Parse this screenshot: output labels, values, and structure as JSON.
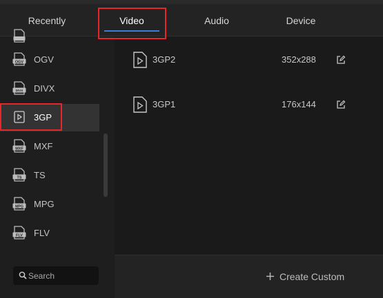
{
  "tabs": [
    {
      "label": "Recently",
      "active": false
    },
    {
      "label": "Video",
      "active": true
    },
    {
      "label": "Audio",
      "active": false
    },
    {
      "label": "Device",
      "active": false
    }
  ],
  "formats": [
    {
      "label": "",
      "icon": "film-format-icon",
      "badge": ""
    },
    {
      "label": "OGV",
      "icon": "ogv-format-icon",
      "badge": "OGV"
    },
    {
      "label": "DIVX",
      "icon": "divx-format-icon",
      "badge": "DIVX"
    },
    {
      "label": "3GP",
      "icon": "play-file-icon",
      "badge": "",
      "selected": true
    },
    {
      "label": "MXF",
      "icon": "mxf-format-icon",
      "badge": "MXF"
    },
    {
      "label": "TS",
      "icon": "ts-format-icon",
      "badge": "TS"
    },
    {
      "label": "MPG",
      "icon": "mpg-format-icon",
      "badge": "MPG"
    },
    {
      "label": "FLV",
      "icon": "flv-format-icon",
      "badge": "FLV"
    }
  ],
  "search": {
    "placeholder": "Search",
    "value": ""
  },
  "presets": [
    {
      "name": "3GP2",
      "resolution": "352x288"
    },
    {
      "name": "3GP1",
      "resolution": "176x144"
    }
  ],
  "footer": {
    "create_label": "Create Custom"
  },
  "colors": {
    "accent": "#3d7bd9",
    "highlight": "#e8262a",
    "selected_bg": "#333333"
  }
}
